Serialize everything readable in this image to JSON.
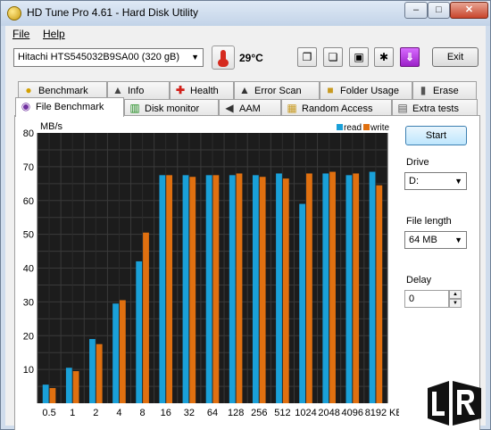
{
  "window": {
    "title": "HD Tune Pro 4.61 - Hard Disk Utility",
    "controls": {
      "minimize": "–",
      "maximize": "□",
      "close": "✕"
    }
  },
  "menu": {
    "file": "File",
    "help": "Help"
  },
  "toolbar": {
    "drive": "Hitachi HTS545032B9SA00 (320 gB)",
    "temperature": "29°C",
    "exit_label": "Exit",
    "icons": [
      "copy-text-icon",
      "copy-info-icon",
      "save-icon",
      "options-icon",
      "download-icon"
    ]
  },
  "tabs": {
    "row1": [
      {
        "label": "Benchmark",
        "icon": "lightbulb-icon"
      },
      {
        "label": "Info",
        "icon": "info-icon"
      },
      {
        "label": "Health",
        "icon": "health-cross-icon"
      },
      {
        "label": "Error Scan",
        "icon": "error-scan-icon"
      },
      {
        "label": "Folder Usage",
        "icon": "folder-icon"
      },
      {
        "label": "Erase",
        "icon": "trash-icon"
      }
    ],
    "row2": [
      {
        "label": "File Benchmark",
        "icon": "file-benchmark-icon",
        "active": true
      },
      {
        "label": "Disk monitor",
        "icon": "chart-icon"
      },
      {
        "label": "AAM",
        "icon": "speaker-icon"
      },
      {
        "label": "Random Access",
        "icon": "random-access-icon"
      },
      {
        "label": "Extra tests",
        "icon": "extra-tests-icon"
      }
    ]
  },
  "side": {
    "start_label": "Start",
    "drive_label": "Drive",
    "drive_value": "D:",
    "file_length_label": "File length",
    "file_length_value": "64 MB",
    "delay_label": "Delay",
    "delay_value": "0"
  },
  "chart_data": {
    "type": "bar",
    "ylabel": "MB/s",
    "xlabel": "KB",
    "ylim": [
      0,
      80
    ],
    "yticks": [
      10,
      20,
      30,
      40,
      50,
      60,
      70,
      80
    ],
    "categories": [
      "0.5",
      "1",
      "2",
      "4",
      "8",
      "16",
      "32",
      "64",
      "128",
      "256",
      "512",
      "1024",
      "2048",
      "4096",
      "8192"
    ],
    "series": [
      {
        "name": "read",
        "color": "#1aa0d8",
        "values": [
          5.5,
          10.5,
          19,
          29.5,
          42,
          67.5,
          67.5,
          67.5,
          67.5,
          67.5,
          68,
          59,
          68,
          67.5,
          68.5
        ]
      },
      {
        "name": "write",
        "color": "#e07010",
        "values": [
          4.5,
          9.5,
          17.5,
          30.5,
          50.5,
          67.5,
          67,
          67.5,
          68,
          67,
          66.5,
          68,
          68.5,
          68,
          64.5
        ]
      }
    ],
    "grid": true,
    "legend": "top-right",
    "background": "#1c1c1c"
  },
  "watermark": {
    "text": "Legit Reviews"
  }
}
